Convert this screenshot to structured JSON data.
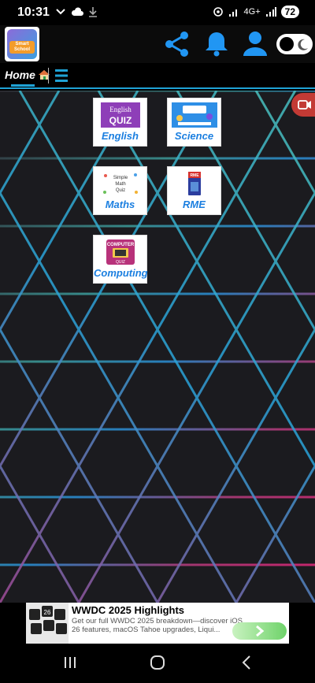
{
  "status_bar": {
    "time": "10:31",
    "battery": "72",
    "network": "4G+"
  },
  "app": {
    "logo_text": "Smart School"
  },
  "nav": {
    "home_label": "Home"
  },
  "subjects": [
    {
      "label": "English",
      "thumb_text": "English QUIZ"
    },
    {
      "label": "Science",
      "thumb_text": ""
    },
    {
      "label": "Maths",
      "thumb_text": "Simple Math Quiz"
    },
    {
      "label": "RME",
      "thumb_text": "RME"
    },
    {
      "label": "Computing",
      "thumb_text": "COMPUTER QUIZ"
    }
  ],
  "ad": {
    "title": "WWDC 2025 Highlights",
    "description": "Get our full WWDC 2025 breakdown—discover iOS 26 features, macOS Tahoe upgrades, Liqui..."
  },
  "colors": {
    "accent": "#1fa3d6",
    "tile_label": "#1b7fe0",
    "icon_blue": "#2196f3"
  }
}
